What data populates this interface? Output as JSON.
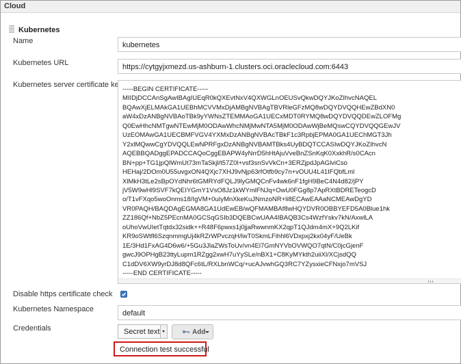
{
  "section": {
    "title": "Cloud"
  },
  "cloud": {
    "title": "Kubernetes"
  },
  "fields": {
    "name": {
      "label": "Name",
      "value": "kubernetes"
    },
    "url": {
      "label": "Kubernetes URL",
      "value": "https://cytgyjxmezd.us-ashburn-1.clusters.oci.oraclecloud.com:6443"
    },
    "certificate": {
      "label": "Kubernetes server certificate key",
      "lines": [
        "-----BEGIN CERTIFICATE-----",
        "MIIDjDCCAnSgAwIBAgIUEqR0kQXEvtNxV4QXWGLnOEUSvQkwDQYJKoZIhvcNAQEL",
        "BQAwXjELMAkGA1UEBhMCVVMxDjAMBgNVBAgTBVRleGFzMQ8wDQYDVQQHEwZBdXN0",
        "aW4xDzANBgNVBAoTBk9yYWNsZTEMMAoGA1UECxMDT0RYMQ8wDQYDVQQDEwZLOFMg",
        "Q0EwHhcNMTgwNTEwMjM0ODAwWhcNMjMwNTA5MjM0ODAwWjBeMQswCQYDVQQGEwJV",
        "UzEOMAwGA1UECBMFVGV4YXMxDzANBgNVBAcTBkF1c3RpbjEPMA0GA1UEChMGT3Jh",
        "Y2xlMQwwCgYDVQQLEwNPRFgxDzANBgNVBAMTBks4UyBDQTCCASIwDQYJKoZIhvcN",
        "AQEBBQADggEPADCCAQoCggEBAPW4yNrrD5hHtAjuVveBnZSnKqK0XxkhR/s0CAcn",
        "BN+pp+TG1jpQlWmUt73mTaSkjl/t57Z0l+vsf3snSvVkCn+3ERZjpdJpAGlviCso",
        "HEHaj/2DOm0U55uvgxON4QXjc7XHJ9vNjp63rfOtfb9cy7n+vOUU4L41IFQbfLml",
        "XlMkH3tLe2sBpOYdNhr6tGMRYdFQLJ9lyGMQCnFv4wk6nF1fgH9BeC4N4d82/jPY",
        "jV5W9wHl9SVF7kQEIYGmY1VsO8Jz1kWYmlFNJq+OwU0FGg8p7ApRXtBDRETeogcD",
        "o/T1vFXqo5woOnms18/IgVM+0uIyMnXkeKuJNmzoNR+li8ECAwEAAaNCMEAwDgYD",
        "VR0PAQH/BAQDAgEGMA8GA1UdEwEB/wQFMAMBAf8wHQYDVR0OBBYEFD5A0Blue1hk",
        "ZZ186Qf+NbZ5PEcnMA0GCSqGSIb3DQEBCwUAA4IBAQB3Cs4WzfYskv7kN/AxwlLA",
        "oUhoVwUIetTqtdx32sidk++R48F6pwxs1j0jjaRwwnmKX2qpT1QJdm4mX+9Q2LKif",
        "KR9oSWtfl6SzqnmmgUj4kRZrWPvczqH/lwT0SkmLFihhl6VDxpxj2kx04yF/UeBk",
        "1E/3Hd1FxAG4D6w6/+5Gu3JlaZWsToUv/vn4El7GmNYVbOVWQO7qtN/C0jcGjenF",
        "gwcJ9OPHgB23ttyLupm1RZgg2xwH7uYySLe/nBX1+C8KyMYkth2uiiXl/XCjsdQQ",
        "C1dDV6XW9yrDJ8d8QFc6tL/RXLbnWCq/+ucAJvwhGQ3RC7YZysxieCFNxjo7mVSJ",
        "-----END CERTIFICATE-----"
      ]
    },
    "disable_https": {
      "label": "Disable https certificate check",
      "checked": true
    },
    "namespace": {
      "label": "Kubernetes Namespace",
      "value": "default"
    },
    "credentials": {
      "label": "Credentials",
      "selected": "Secret text",
      "add_label": "Add"
    }
  },
  "status": {
    "message": "Connection test successful",
    "border_color": "#d01818"
  },
  "colors": {
    "checkbox": "#3e78c6"
  },
  "icons": {
    "add": "key-icon",
    "grip": "drag-handle-icon"
  }
}
